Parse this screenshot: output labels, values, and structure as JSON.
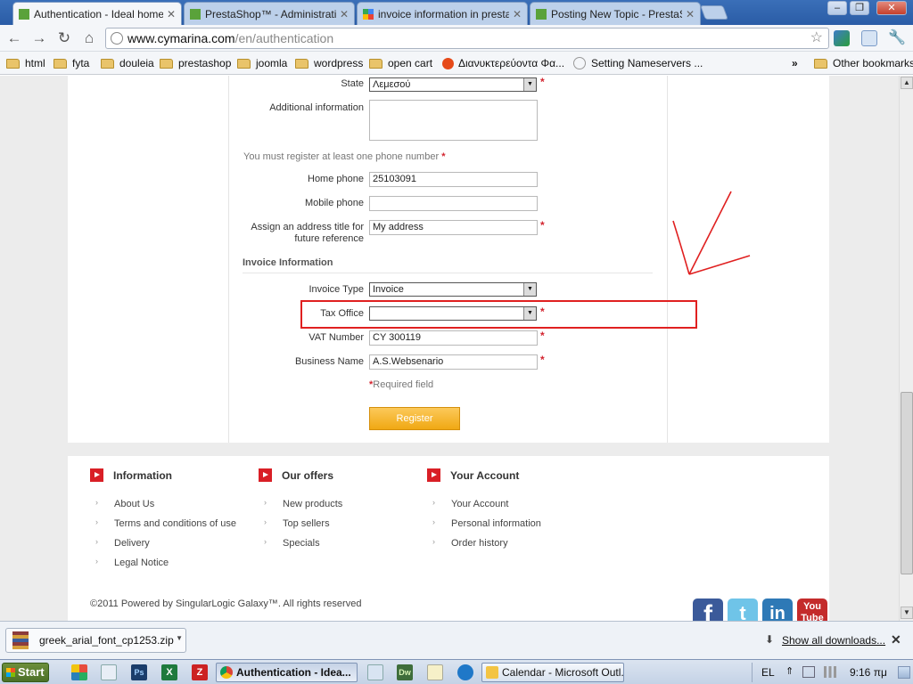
{
  "browser": {
    "tabs": [
      {
        "title": "Authentication - Ideal home el",
        "active": true
      },
      {
        "title": "PrestaShop™ - Administration",
        "active": false
      },
      {
        "title": "invoice information in prestash",
        "active": false
      },
      {
        "title": "Posting New Topic - PrestaSho",
        "active": false
      }
    ],
    "url_domain": "www.cymarina.com",
    "url_path": "/en/authentication",
    "bookmarks": [
      "html",
      "fyta",
      "douleia",
      "prestashop",
      "joomla",
      "wordpress",
      "open cart",
      "Διανυκτερεύοντα Φα...",
      "Setting Nameservers ..."
    ],
    "other_bookmarks": "Other bookmarks",
    "chevron": "»"
  },
  "form": {
    "state_label": "State",
    "state_value": "Λεμεσού",
    "additional_info_label": "Additional information",
    "phone_note": "You must register at least one phone number",
    "home_phone_label": "Home phone",
    "home_phone_value": "25103091",
    "mobile_phone_label": "Mobile phone",
    "mobile_phone_value": "",
    "alias_label_1": "Assign an address title for",
    "alias_label_2": "future reference",
    "alias_value": "My address",
    "invoice_section": "Invoice Information",
    "invoice_type_label": "Invoice Type",
    "invoice_type_value": "Invoice",
    "tax_office_label": "Tax Office",
    "tax_office_value": "",
    "vat_label": "VAT Number",
    "vat_value": "CY 300119",
    "business_label": "Business Name",
    "business_value": "A.S.Websenario",
    "required_star": "*",
    "required_note": "Required field",
    "register_label": "Register"
  },
  "footer": {
    "columns": [
      {
        "title": "Information",
        "links": [
          "About Us",
          "Terms and conditions of use",
          "Delivery",
          "Legal Notice"
        ]
      },
      {
        "title": "Our offers",
        "links": [
          "New products",
          "Top sellers",
          "Specials"
        ]
      },
      {
        "title": "Your Account",
        "links": [
          "Your Account",
          "Personal information",
          "Order history"
        ]
      }
    ],
    "copyright": "©2011 Powered by SingularLogic Galaxy™. All rights reserved",
    "social": [
      "facebook-icon",
      "twitter-icon",
      "linkedin-icon",
      "youtube-icon"
    ],
    "youtube_text_1": "You",
    "youtube_text_2": "Tube",
    "linkedin_text": "in",
    "facebook_text": "f"
  },
  "downloads": {
    "file": "greek_arial_font_cp1253.zip",
    "show_all": "Show all downloads...",
    "close": "✕"
  },
  "taskbar": {
    "start": "Start",
    "windows": [
      "Authentication - Idea...",
      "Calendar - Microsoft Outl..."
    ],
    "language": "EL",
    "clock": "9:16 πμ"
  },
  "colors": {
    "required": "#d3242f",
    "annotation": "#e02020",
    "register": "#f0a813",
    "footer_icon": "#d91f26"
  }
}
